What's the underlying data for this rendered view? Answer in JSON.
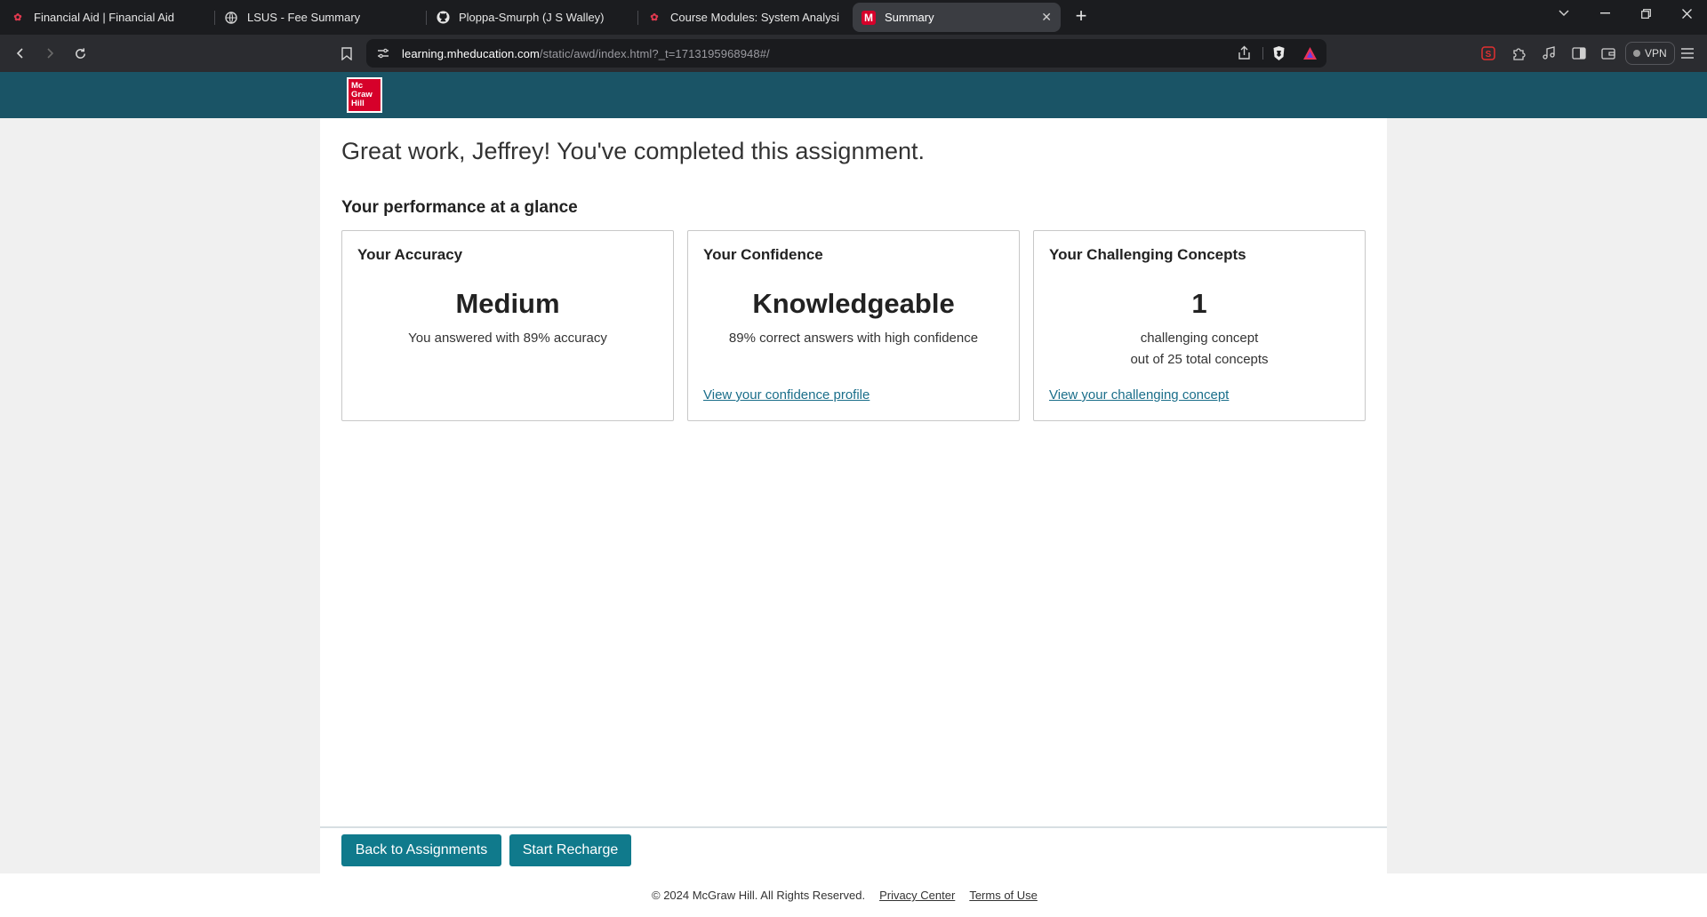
{
  "browser": {
    "tabs": [
      {
        "title": "Financial Aid | Financial Aid",
        "favicon": "lsus-logo-icon",
        "active": false
      },
      {
        "title": "LSUS - Fee Summary",
        "favicon": "globe-icon",
        "active": false
      },
      {
        "title": "Ploppa-Smurph (J S Walley)",
        "favicon": "github-icon",
        "active": false
      },
      {
        "title": "Course Modules: System Analysis and",
        "favicon": "lsus-logo-icon",
        "active": false
      },
      {
        "title": "Summary",
        "favicon": "mcgraw-hill-m-icon",
        "active": true
      }
    ],
    "url_host": "learning.mheducation.com",
    "url_path": "/static/awd/index.html?_t=1713195968948#/",
    "vpn_label": "VPN"
  },
  "header": {
    "logo_lines": [
      "Mc",
      "Graw",
      "Hill"
    ],
    "brand_color": "#1a5466",
    "logo_color": "#d6002a"
  },
  "main": {
    "headline": "Great work, Jeffrey! You've completed this assignment.",
    "subheading": "Your performance at a glance",
    "cards": [
      {
        "title": "Your Accuracy",
        "value": "Medium",
        "description": "You answered with 89% accuracy",
        "description2": "",
        "link": ""
      },
      {
        "title": "Your Confidence",
        "value": "Knowledgeable",
        "description": "89% correct answers with high confidence",
        "description2": "",
        "link": "View your confidence profile"
      },
      {
        "title": "Your Challenging Concepts",
        "value": "1",
        "description": "challenging concept",
        "description2": "out of 25 total concepts",
        "link": "View your challenging concept"
      }
    ],
    "buttons": {
      "back": "Back to Assignments",
      "recharge": "Start Recharge"
    },
    "accent_color": "#107a8c"
  },
  "footer": {
    "copyright": "© 2024 McGraw Hill. All Rights Reserved.",
    "privacy": "Privacy Center",
    "terms": "Terms of Use"
  }
}
